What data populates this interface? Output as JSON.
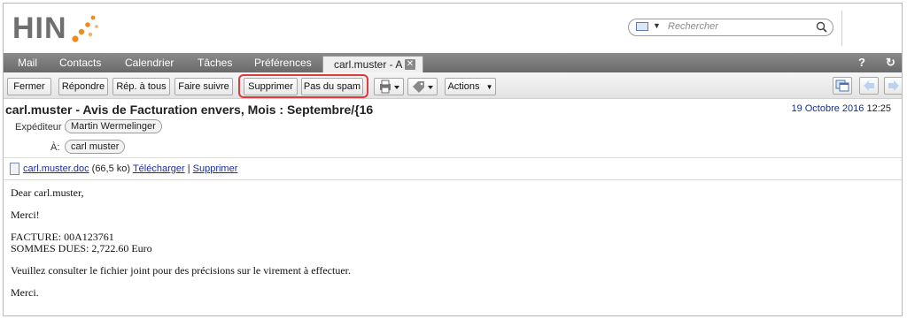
{
  "header": {
    "logo_text": "HIN",
    "search_placeholder": "Rechercher"
  },
  "nav": {
    "tabs": [
      "Mail",
      "Contacts",
      "Calendrier",
      "Tâches",
      "Préférences"
    ],
    "active_tab": "carl.muster - A",
    "help_label": "?"
  },
  "toolbar": {
    "fermer": "Fermer",
    "repondre": "Répondre",
    "rep_tous": "Rép. à tous",
    "faire_suivre": "Faire suivre",
    "supprimer": "Supprimer",
    "pas_spam": "Pas du spam",
    "actions": "Actions"
  },
  "message": {
    "subject": "carl.muster - Avis de Facturation envers, Mois : Septembre/{16",
    "date": "19 Octobre 2016",
    "time": "12:25",
    "sender_label": "Expéditeur :",
    "sender": "Martin Wermelinger",
    "to_label": "À:",
    "to": "carl muster",
    "attachment": {
      "filename": "carl.muster.doc",
      "size": "(66,5 ko)",
      "download": "Télécharger",
      "separator": "|",
      "delete": "Supprimer"
    },
    "body_lines": [
      "Dear carl.muster,",
      "Merci!",
      "FACTURE: 00A123761",
      "SOMMES DUES: 2,722.60 Euro",
      "Veuillez consulter le fichier joint pour des précisions sur le virement à effectuer.",
      "Merci."
    ]
  },
  "colors": {
    "nav_bg": "#7a7a7a",
    "highlight": "#e0393e",
    "logo_orange": "#f08a1c",
    "date_blue": "#1a2d84"
  }
}
